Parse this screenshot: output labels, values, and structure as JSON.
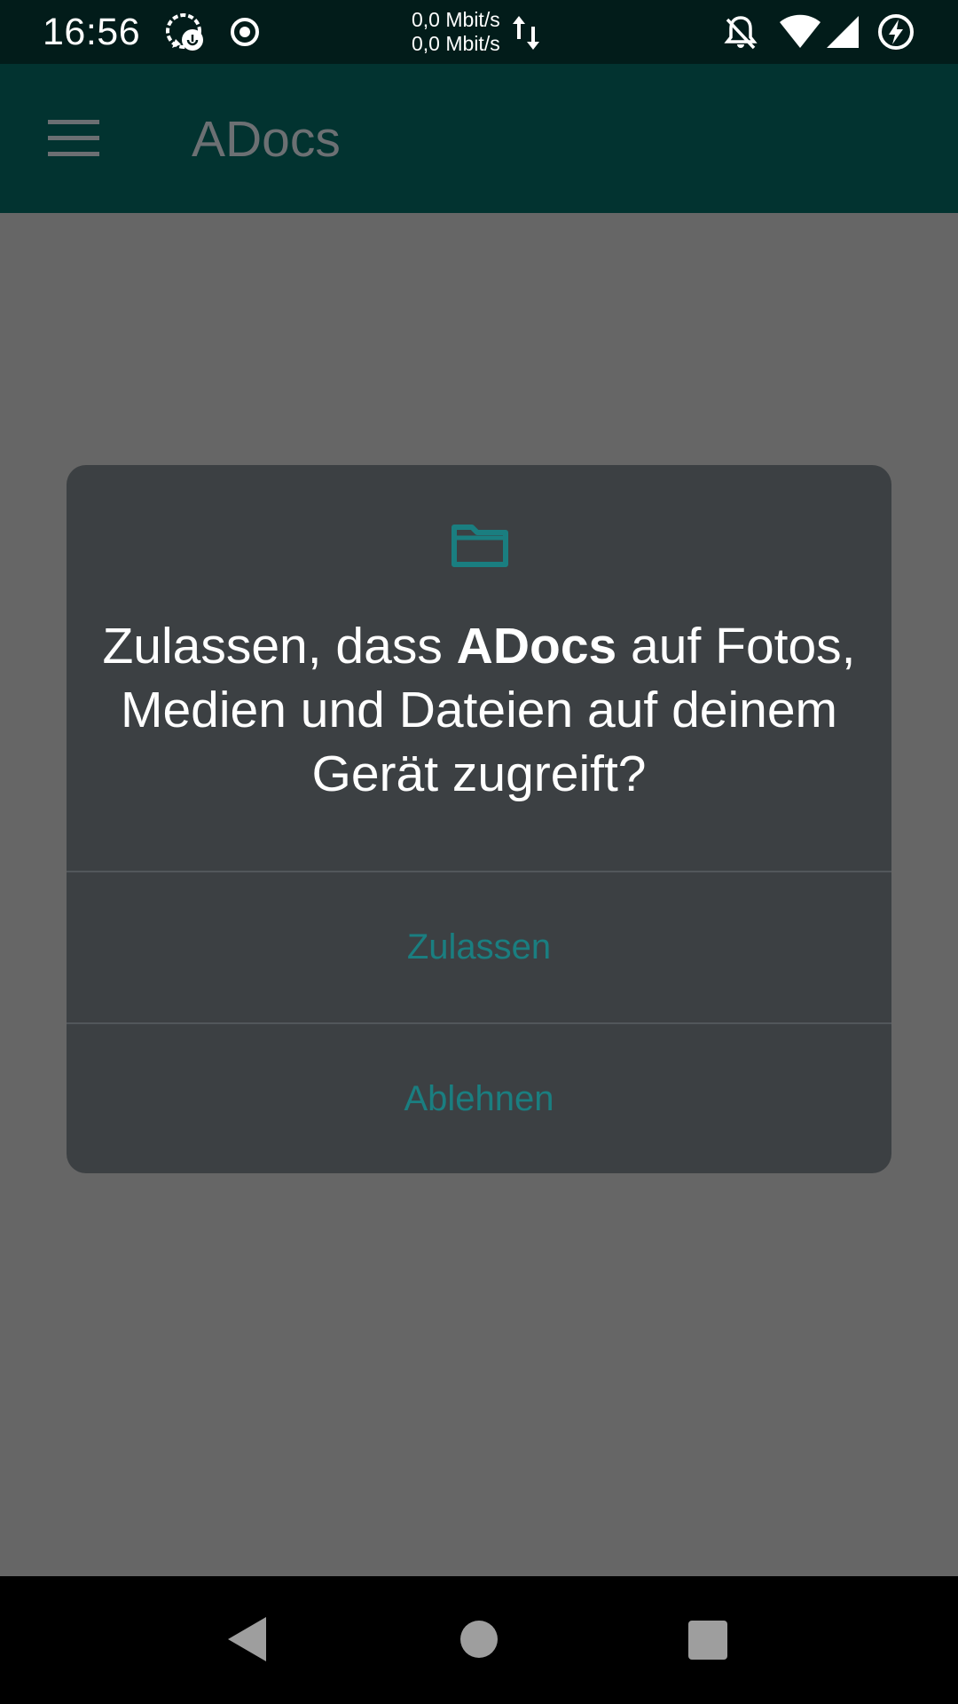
{
  "status_bar": {
    "time": "16:56",
    "net_speed_up": "0,0 Mbit/s",
    "net_speed_down": "0,0 Mbit/s",
    "icons": [
      "messenger-icon",
      "record-icon",
      "data-arrows-icon",
      "notifications-off-icon",
      "wifi-icon",
      "cell-signal-icon",
      "battery-charging-icon"
    ]
  },
  "app_bar": {
    "title": "ADocs"
  },
  "dialog": {
    "title_prefix": "Zulassen, dass ",
    "title_app": "ADocs",
    "title_suffix": " auf Fotos, Medien und Dateien auf deinem Gerät zugreift?",
    "allow_label": "Zulassen",
    "deny_label": "Ablehnen",
    "icon": "folder-icon"
  },
  "colors": {
    "accent": "#1a7e80",
    "app_bar": "#023330",
    "status_bar": "#021c1a",
    "dialog_bg": "#3c4043",
    "scrim": "#666666"
  },
  "nav_bar": {
    "icons": [
      "back-icon",
      "home-icon",
      "recents-icon"
    ]
  }
}
